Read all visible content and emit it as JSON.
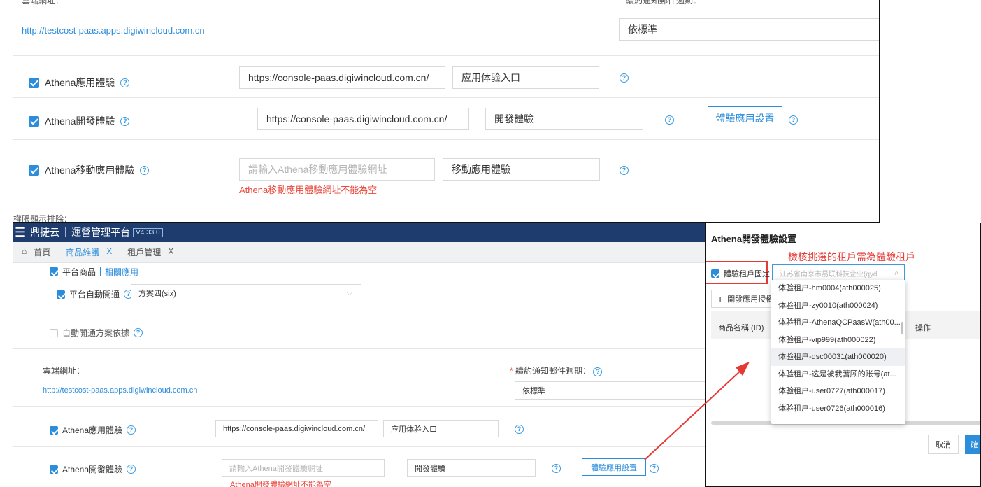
{
  "top": {
    "partial_top_left": "雲端網址：",
    "partial_top_right": "續約通知郵件週期：",
    "cloud_url": "http://testcost-paas.apps.digiwincloud.com.cn",
    "notify_cycle": "依標準",
    "rows": [
      {
        "label": "Athena應用體驗",
        "url": "https://console-paas.digiwincloud.com.cn/",
        "name": "应用体验入口"
      },
      {
        "label": "Athena開發體驗",
        "url": "https://console-paas.digiwincloud.com.cn/",
        "name": "開發體驗",
        "button": "體驗應用設置"
      },
      {
        "label": "Athena移動應用體驗",
        "url_placeholder": "請輸入Athena移動應用體驗網址",
        "name": "移動應用體驗",
        "error": "Athena移動應用體驗網址不能為空"
      }
    ],
    "partial_bottom": "權限顯示排除："
  },
  "bottom": {
    "brand": "鼎捷云",
    "platform": "運營管理平台",
    "version": "V4.33.0",
    "tabs": [
      {
        "label": "首頁"
      },
      {
        "label": "商品維護",
        "close": "X"
      },
      {
        "label": "租戶管理",
        "close": "X"
      }
    ],
    "platform_goods": "平台商品",
    "related_app": "相關應用",
    "auto_open": "平台自動開通",
    "plan_value": "方案四(six)",
    "auto_open_basis": "自動開通方案依據",
    "cloud_url_label": "雲端網址：",
    "cloud_url": "http://testcost-paas.apps.digiwincloud.com.cn",
    "notify_label": "續約通知郵件週期：",
    "notify_value": "依標準",
    "rows": [
      {
        "label": "Athena應用體驗",
        "url": "https://console-paas.digiwincloud.com.cn/",
        "name": "应用体验入口"
      },
      {
        "label": "Athena開發體驗",
        "url_placeholder": "請輸入Athena開發體驗網址",
        "name": "開發體驗",
        "button": "體驗應用設置",
        "error": "Athena開發體驗網址不能為空"
      }
    ]
  },
  "dialog": {
    "title": "Athena開發體驗設置",
    "annotation": "檢核挑選的租戶需為體驗租戶",
    "tenant_fixed_label": "體驗租戶固定",
    "tenant_search_placeholder": "江苏省南京市易联科技企业(qyd...",
    "add_auth_button": "開發應用授權",
    "column_name": "商品名稱 (ID)",
    "column_action": "操作",
    "cancel": "取消",
    "confirm": "確"
  },
  "dropdown": {
    "items": [
      "体验租户-hm0004(ath000025)",
      "体验租户-zy0010(ath000024)",
      "体验租户-AthenaQCPaasW(ath00...",
      "体验租户-vip999(ath000022)",
      "体验租户-dsc00031(ath000020)",
      "体验租户-这是被我蓍顾的账号(at...",
      "体验租户-user0727(ath000017)",
      "体验租户-user0726(ath000016)"
    ],
    "highlighted_index": 4
  },
  "colors": {
    "accent": "#2c8ddb",
    "error": "#e9453a",
    "topbar": "#1e3d6e",
    "annotation_box": "#e53935"
  }
}
